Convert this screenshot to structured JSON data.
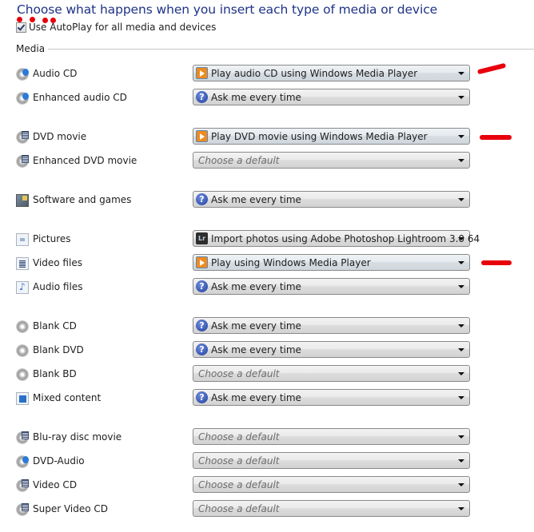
{
  "header": {
    "title": "Choose what happens when you insert each type of media or device",
    "autoplay_checkbox": {
      "label": "Use AutoPlay for all media and devices",
      "checked": true
    }
  },
  "section": {
    "label": "Media"
  },
  "rows": [
    {
      "label": "Audio CD",
      "icon": "audio-cd-icon",
      "value": "Play audio CD using Windows Media Player",
      "value_icon": "windows-media-player-icon",
      "placeholder": false
    },
    {
      "label": "Enhanced audio CD",
      "icon": "audio-cd-icon",
      "value": "Ask me every time",
      "value_icon": "question-icon",
      "placeholder": false
    },
    {
      "label": "DVD movie",
      "icon": "dvd-movie-icon",
      "value": "Play DVD movie using Windows Media Player",
      "value_icon": "windows-media-player-icon",
      "placeholder": false
    },
    {
      "label": "Enhanced DVD movie",
      "icon": "dvd-movie-icon",
      "value": "Choose a default",
      "value_icon": "",
      "placeholder": true
    },
    {
      "label": "Software and games",
      "icon": "software-icon",
      "value": "Ask me every time",
      "value_icon": "question-icon",
      "placeholder": false
    },
    {
      "label": "Pictures",
      "icon": "picture-file-icon",
      "value": "Import photos using Adobe Photoshop Lightroom 3.0 64",
      "value_icon": "lightroom-icon",
      "placeholder": false
    },
    {
      "label": "Video files",
      "icon": "video-file-icon",
      "value": "Play using Windows Media Player",
      "value_icon": "windows-media-player-icon",
      "placeholder": false
    },
    {
      "label": "Audio files",
      "icon": "audio-file-icon",
      "value": "Ask me every time",
      "value_icon": "question-icon",
      "placeholder": false
    },
    {
      "label": "Blank CD",
      "icon": "blank-disc-icon",
      "value": "Ask me every time",
      "value_icon": "question-icon",
      "placeholder": false
    },
    {
      "label": "Blank DVD",
      "icon": "blank-disc-icon",
      "value": "Ask me every time",
      "value_icon": "question-icon",
      "placeholder": false
    },
    {
      "label": "Blank BD",
      "icon": "blank-disc-icon",
      "value": "Choose a default",
      "value_icon": "",
      "placeholder": true
    },
    {
      "label": "Mixed content",
      "icon": "mixed-content-icon",
      "value": "Ask me every time",
      "value_icon": "question-icon",
      "placeholder": false
    },
    {
      "label": "Blu-ray disc movie",
      "icon": "dvd-movie-icon",
      "value": "Choose a default",
      "value_icon": "",
      "placeholder": true
    },
    {
      "label": "DVD-Audio",
      "icon": "audio-cd-icon",
      "value": "Choose a default",
      "value_icon": "",
      "placeholder": true
    },
    {
      "label": "Video CD",
      "icon": "dvd-movie-icon",
      "value": "Choose a default",
      "value_icon": "",
      "placeholder": true
    },
    {
      "label": "Super Video CD",
      "icon": "dvd-movie-icon",
      "value": "Choose a default",
      "value_icon": "",
      "placeholder": true
    }
  ],
  "annotations": {
    "color": "#e8000d",
    "marked_rows": [
      "Audio CD",
      "DVD movie",
      "Video files"
    ]
  }
}
